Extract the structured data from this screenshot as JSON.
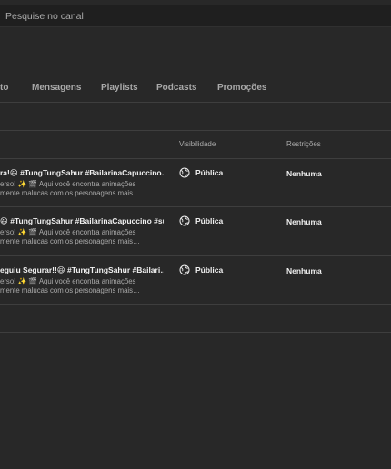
{
  "search": {
    "placeholder": "Pesquise no canal"
  },
  "tabs": [
    {
      "label": "to"
    },
    {
      "label": "Mensagens"
    },
    {
      "label": "Playlists"
    },
    {
      "label": "Podcasts"
    },
    {
      "label": "Promoções"
    }
  ],
  "table": {
    "headers": {
      "visibility": "Visibilidade",
      "restrictions": "Restrições"
    },
    "rows": [
      {
        "title": "ra!😆 #TungTungSahur #BailarinaCapuccino…",
        "desc1": "erso! ✨ 🎬 Aqui você encontra animações",
        "desc2": "mente malucas com os personagens mais…",
        "visibility": "Pública",
        "restrictions": "Nenhuma"
      },
      {
        "title": "😆 #TungTungSahur #BailarinaCapuccino #su…",
        "desc1": "erso! ✨ 🎬 Aqui você encontra animações",
        "desc2": "mente malucas com os personagens mais…",
        "visibility": "Pública",
        "restrictions": "Nenhuma"
      },
      {
        "title": "eguiu Segurar!!😆 #TungTungSahur #Bailari…",
        "desc1": "erso! ✨ 🎬 Aqui você encontra animações",
        "desc2": "mente malucas com os personagens mais…",
        "visibility": "Pública",
        "restrictions": "Nenhuma"
      }
    ]
  },
  "icons": {
    "visibility": "globe-icon"
  },
  "colors": {
    "background": "#282828",
    "searchbar": "#1f1f1f",
    "divider": "#3e3e3e",
    "text": "#f1f1f1",
    "muted": "#aaaaaa"
  }
}
